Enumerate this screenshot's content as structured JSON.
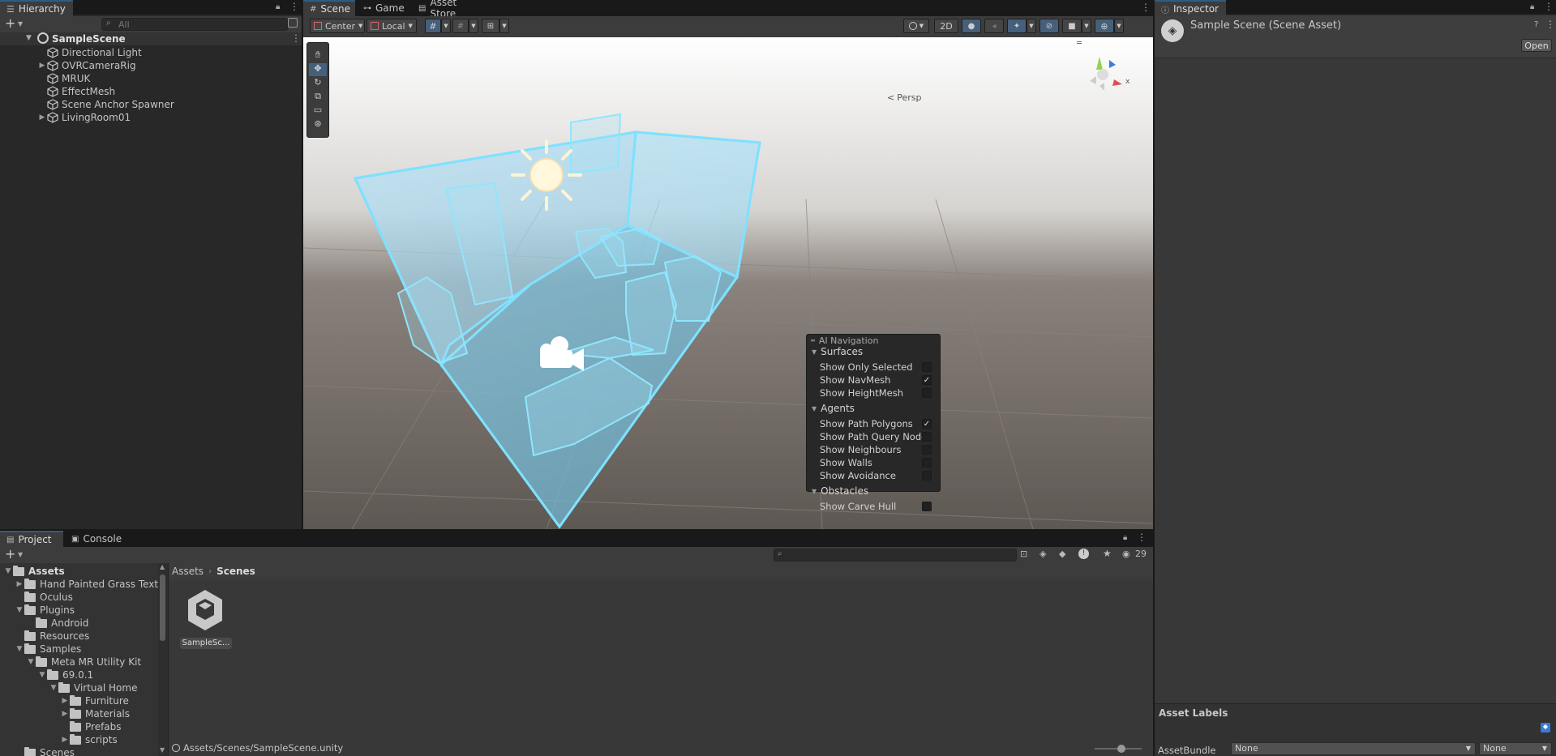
{
  "hierarchy": {
    "tab_label": "Hierarchy",
    "search_placeholder": "All",
    "scene_name": "SampleScene",
    "items": [
      {
        "label": "Directional Light",
        "expandable": false
      },
      {
        "label": "OVRCameraRig",
        "expandable": true
      },
      {
        "label": "MRUK",
        "expandable": false
      },
      {
        "label": "EffectMesh",
        "expandable": false
      },
      {
        "label": "Scene Anchor Spawner",
        "expandable": false
      },
      {
        "label": "LivingRoom01",
        "expandable": true
      }
    ]
  },
  "scene_tabs": [
    {
      "label": "Scene"
    },
    {
      "label": "Game"
    },
    {
      "label": "Asset Store"
    }
  ],
  "scene_toolbar": {
    "pivot_mode": "Center",
    "pivot_rotation": "Local",
    "mode_2d": "2D"
  },
  "scene_view": {
    "projection_label": "Persp",
    "gizmo_axis_x": "x"
  },
  "ai_navigation": {
    "title": "AI Navigation",
    "sections": [
      {
        "title": "Surfaces",
        "options": [
          {
            "label": "Show Only Selected",
            "checked": false
          },
          {
            "label": "Show NavMesh",
            "checked": true
          },
          {
            "label": "Show HeightMesh",
            "checked": false
          }
        ]
      },
      {
        "title": "Agents",
        "options": [
          {
            "label": "Show Path Polygons",
            "checked": true
          },
          {
            "label": "Show Path Query Nodes",
            "checked": false
          },
          {
            "label": "Show Neighbours",
            "checked": false
          },
          {
            "label": "Show Walls",
            "checked": false
          },
          {
            "label": "Show Avoidance",
            "checked": false
          }
        ]
      },
      {
        "title": "Obstacles",
        "options": [
          {
            "label": "Show Carve Hull",
            "checked": false
          }
        ]
      }
    ]
  },
  "inspector": {
    "tab_label": "Inspector",
    "title": "Sample Scene (Scene Asset)",
    "open_button": "Open",
    "asset_labels_title": "Asset Labels",
    "assetbundle_label": "AssetBundle",
    "assetbundle_value": "None",
    "assetbundle_variant": "None"
  },
  "project": {
    "tabs": [
      "Project",
      "Console"
    ],
    "hidden_count": "29",
    "breadcrumb": [
      "Assets",
      "Scenes"
    ],
    "tree": [
      {
        "label": "Assets",
        "depth": 0,
        "arrow": "open",
        "bold": true
      },
      {
        "label": "Hand Painted Grass  Textu",
        "depth": 1,
        "arrow": "closed"
      },
      {
        "label": "Oculus",
        "depth": 1,
        "arrow": "none"
      },
      {
        "label": "Plugins",
        "depth": 1,
        "arrow": "open"
      },
      {
        "label": "Android",
        "depth": 2,
        "arrow": "none"
      },
      {
        "label": "Resources",
        "depth": 1,
        "arrow": "none"
      },
      {
        "label": "Samples",
        "depth": 1,
        "arrow": "open"
      },
      {
        "label": "Meta MR Utility Kit",
        "depth": 2,
        "arrow": "open"
      },
      {
        "label": "69.0.1",
        "depth": 3,
        "arrow": "open"
      },
      {
        "label": "Virtual Home",
        "depth": 4,
        "arrow": "open"
      },
      {
        "label": "Furniture",
        "depth": 5,
        "arrow": "closed"
      },
      {
        "label": "Materials",
        "depth": 5,
        "arrow": "closed"
      },
      {
        "label": "Prefabs",
        "depth": 5,
        "arrow": "none"
      },
      {
        "label": "scripts",
        "depth": 5,
        "arrow": "closed"
      },
      {
        "label": "Scenes",
        "depth": 1,
        "arrow": "none"
      }
    ],
    "asset_item": "SampleSc...",
    "status_path": "Assets/Scenes/SampleScene.unity"
  }
}
